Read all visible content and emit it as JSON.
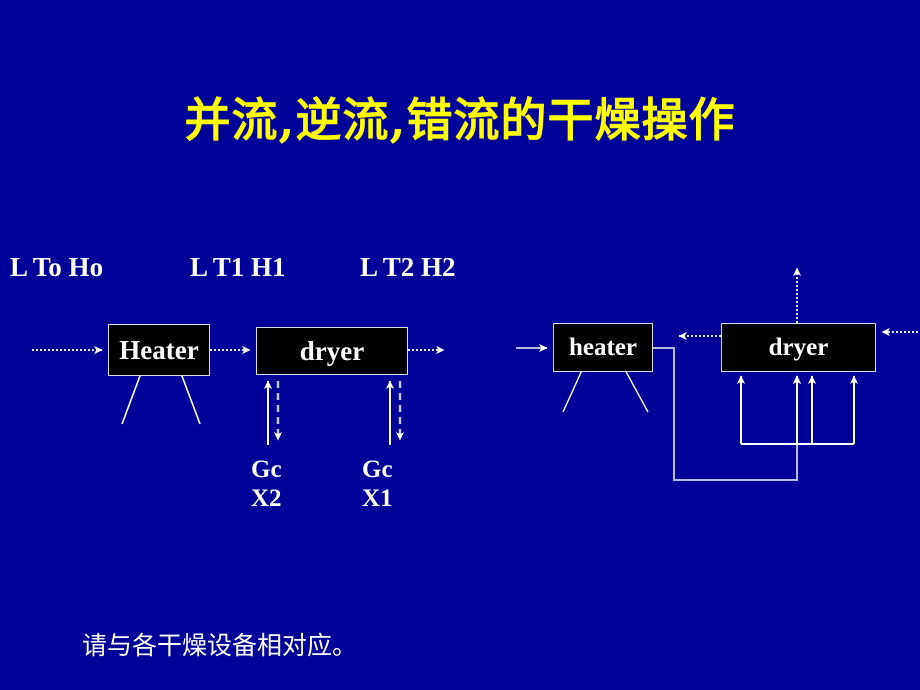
{
  "slide": {
    "background_color": "#000099",
    "title": {
      "text": "并流,逆流,错流的干燥操作",
      "color": "#ffff00"
    },
    "caption": {
      "text": "请与各干燥设备相对应。",
      "color": "#ffffff"
    }
  },
  "stream_labels": [
    {
      "id": "inlet-stream",
      "text": "L To Ho"
    },
    {
      "id": "mid-stream",
      "text": "L T1 H1"
    },
    {
      "id": "outlet-stream",
      "text": "L T2 H2"
    }
  ],
  "diagram_left": {
    "name": "co-current-flow-diagram",
    "heater": {
      "label": "Heater"
    },
    "dryer": {
      "label": "dryer"
    },
    "solids_streams": [
      {
        "id": "solids-stream-2",
        "mass_flow": "Gc",
        "moisture": "X2"
      },
      {
        "id": "solids-stream-1",
        "mass_flow": "Gc",
        "moisture": "X1"
      }
    ]
  },
  "diagram_right": {
    "name": "recirculation-flow-diagram",
    "heater": {
      "label": "heater"
    },
    "dryer": {
      "label": "dryer"
    }
  },
  "colors": {
    "background": "#000099",
    "title": "#ffff00",
    "text": "#ffffff",
    "box_fill": "#000000",
    "box_border": "#d8d8e8",
    "wire": "#ffffff",
    "wire_dim": "#b9b9e0"
  }
}
